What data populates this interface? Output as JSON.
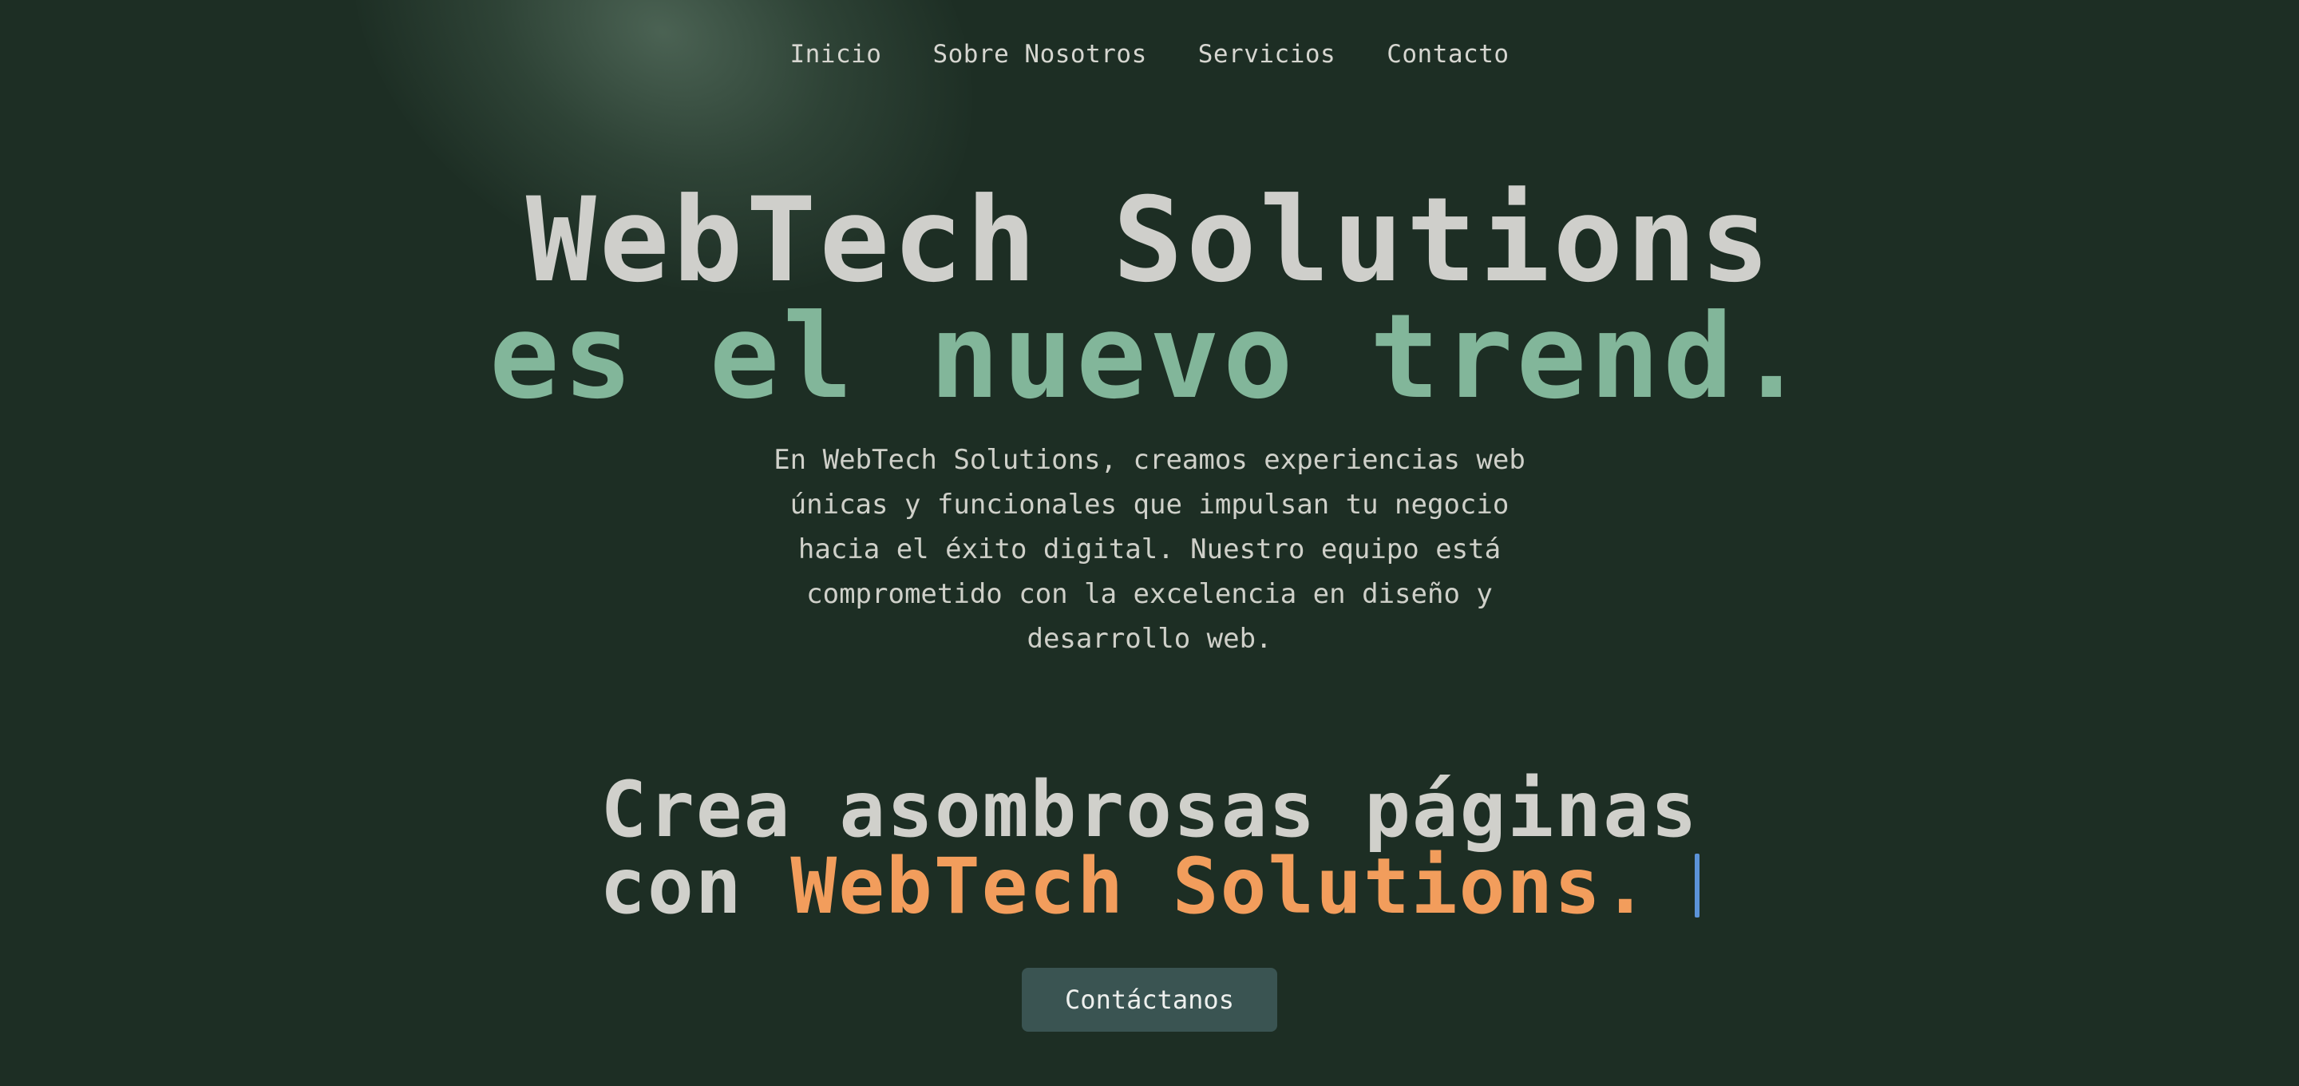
{
  "nav": {
    "items": [
      "Inicio",
      "Sobre Nosotros",
      "Servicios",
      "Contacto"
    ]
  },
  "hero": {
    "title_line1": "WebTech Solutions",
    "title_line2": "es el nuevo trend.",
    "description_lines": [
      "En WebTech Solutions, creamos experiencias web",
      "únicas y funcionales que impulsan tu negocio",
      "hacia el éxito digital. Nuestro equipo está",
      "comprometido con la excelencia en diseño y",
      "desarrollo web."
    ]
  },
  "tagline": {
    "line1": "Crea asombrosas páginas",
    "line2_prefix": "con",
    "line2_brand": "WebTech Solutions."
  },
  "cta": {
    "label": "Contáctanos"
  },
  "colors": {
    "background": "#1d2e24",
    "title_light": "#cfcfcb",
    "title_green": "#82b69a",
    "brand_orange": "#f29d5c",
    "cursor_blue": "#5b93d8",
    "button_bg": "#3a5452"
  }
}
